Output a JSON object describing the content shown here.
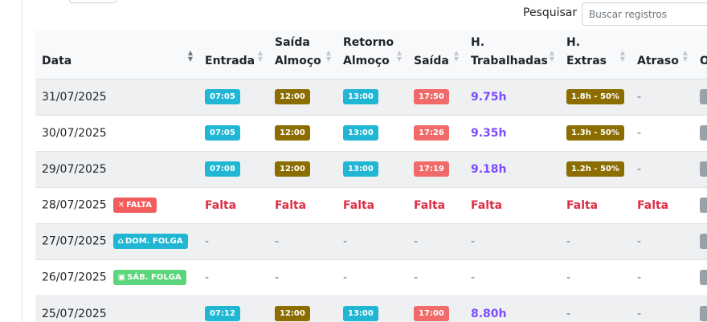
{
  "search": {
    "label": "Pesquisar",
    "placeholder": "Buscar registros"
  },
  "columns": [
    "Data",
    "Entrada",
    "Saída\nAlmoço",
    "Retorno\nAlmoço",
    "Saída",
    "H.\nTrabalhadas",
    "H.\nExtras",
    "Atraso",
    "O"
  ],
  "rows": [
    {
      "date": "31/07/2025",
      "entrada": "07:05",
      "saida_almoco": "12:00",
      "retorno_almoco": "13:00",
      "saida": "17:50",
      "horas": "9.75h",
      "extras": "1.8h - 50%",
      "atraso": "-"
    },
    {
      "date": "30/07/2025",
      "entrada": "07:05",
      "saida_almoco": "12:00",
      "retorno_almoco": "13:00",
      "saida": "17:26",
      "horas": "9.35h",
      "extras": "1.3h - 50%",
      "atraso": "-"
    },
    {
      "date": "29/07/2025",
      "entrada": "07:08",
      "saida_almoco": "12:00",
      "retorno_almoco": "13:00",
      "saida": "17:19",
      "horas": "9.18h",
      "extras": "1.2h - 50%",
      "atraso": "-"
    },
    {
      "date": "28/07/2025",
      "status": "FALTA",
      "falta": "Falta"
    },
    {
      "date": "27/07/2025",
      "status": "DOM. FOLGA",
      "dash": "-"
    },
    {
      "date": "26/07/2025",
      "status": "SÁB. FOLGA",
      "dash": "-"
    },
    {
      "date": "25/07/2025",
      "entrada": "07:12",
      "saida_almoco": "12:00",
      "retorno_almoco": "13:00",
      "saida": "17:00",
      "horas": "8.80h",
      "extras": "-",
      "atraso": "-"
    }
  ],
  "colors": {
    "cyan": "#20b6d4",
    "olive": "#8c6d00",
    "red": "#f06a6a",
    "purple": "#7c4dff",
    "falta": "#dc2f45",
    "folga_green": "#5cd67c"
  }
}
